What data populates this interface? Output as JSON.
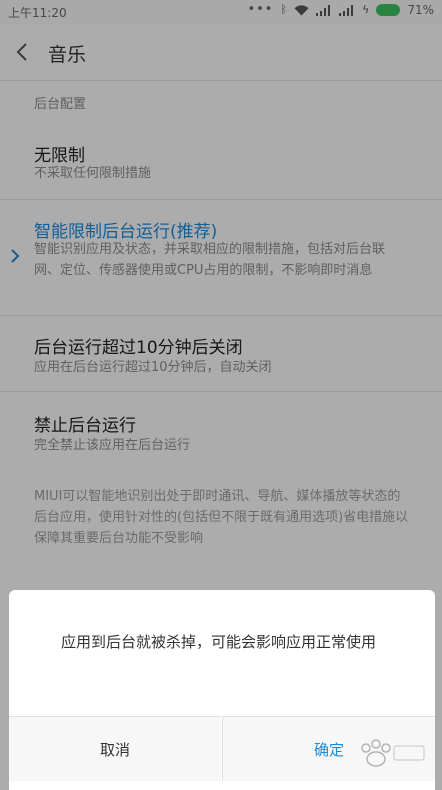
{
  "status_bar": {
    "time": "上午11:20",
    "dots": "•••",
    "battery_percent": "71%",
    "battery_color": "#3cbd5d"
  },
  "header": {
    "back_icon": "chevron-left-icon",
    "title": "音乐"
  },
  "section_label": "后台配置",
  "options": [
    {
      "title": "无限制",
      "desc": "不采取任何限制措施",
      "selected": false
    },
    {
      "title": "智能限制后台运行(推荐)",
      "desc": "智能识别应用及状态，并采取相应的限制措施，包括对后台联网、定位、传感器使用或CPU占用的限制，不影响即时消息",
      "selected": true
    },
    {
      "title": "后台运行超过10分钟后关闭",
      "desc": "应用在后台运行超过10分钟后，自动关闭",
      "selected": false
    },
    {
      "title": "禁止后台运行",
      "desc": "完全禁止该应用在后台运行",
      "selected": false
    }
  ],
  "footnote": "MIUI可以智能地识别出处于即时通讯、导航、媒体播放等状态的后台应用，使用针对性的(包括但不限于既有通用选项)省电措施以保障其重要后台功能不受影响",
  "dialog": {
    "message": "应用到后台就被杀掉，可能会影响应用正常使用",
    "cancel_label": "取消",
    "ok_label": "确定"
  },
  "colors": {
    "accent": "#1a89d8",
    "overlay": "rgba(0,0,0,0.30)"
  }
}
